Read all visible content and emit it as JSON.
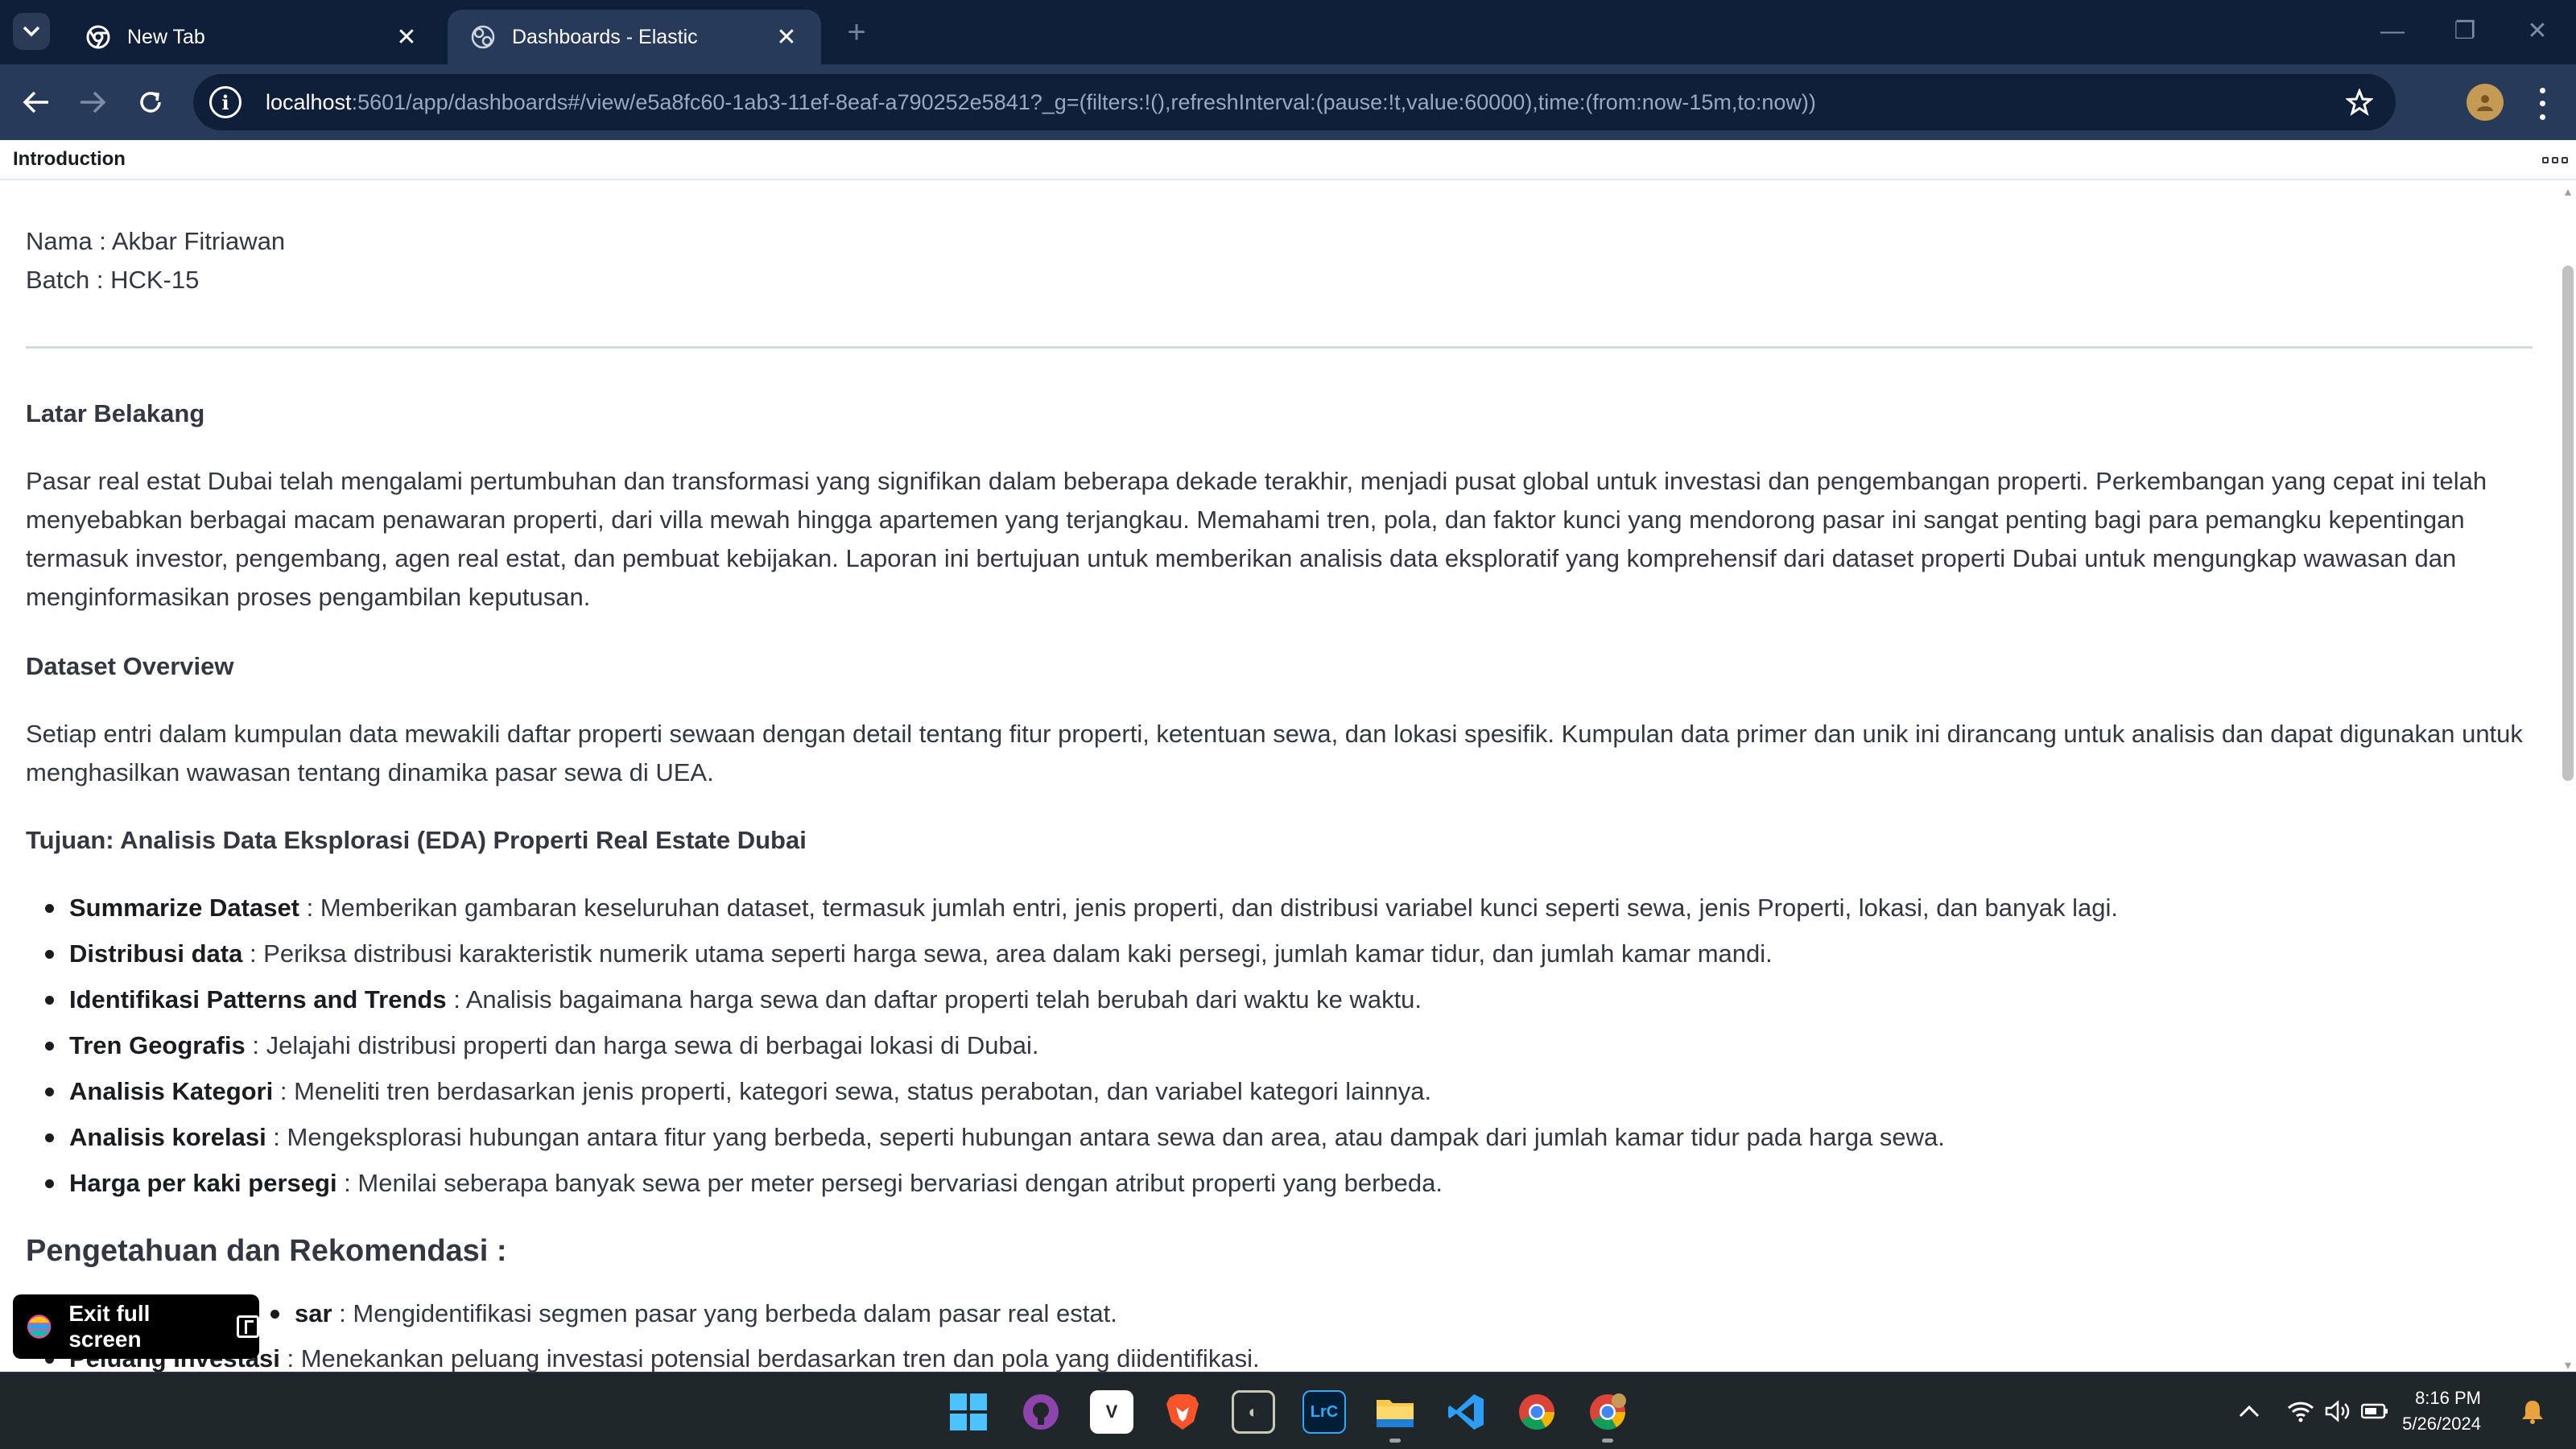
{
  "browser": {
    "tabs": [
      {
        "title": "New Tab",
        "active": false
      },
      {
        "title": "Dashboards - Elastic",
        "active": true
      }
    ],
    "url_host": "localhost",
    "url_rest": ":5601/app/dashboards#/view/e5a8fc60-1ab3-11ef-8eaf-a790252e5841?_g=(filters:!(),refreshInterval:(pause:!t,value:60000),time:(from:now-15m,to:now))"
  },
  "panel": {
    "title": "Introduction"
  },
  "content": {
    "nama": "Nama : Akbar Fitriawan",
    "batch": "Batch : HCK-15",
    "latar_heading": "Latar Belakang",
    "latar_text": "Pasar real estat Dubai telah mengalami pertumbuhan dan transformasi yang signifikan dalam beberapa dekade terakhir, menjadi pusat global untuk investasi dan pengembangan properti. Perkembangan yang cepat ini telah menyebabkan berbagai macam penawaran properti, dari villa mewah hingga apartemen yang terjangkau. Memahami tren, pola, dan faktor kunci yang mendorong pasar ini sangat penting bagi para pemangku kepentingan termasuk investor, pengembang, agen real estat, dan pembuat kebijakan. Laporan ini bertujuan untuk memberikan analisis data eksploratif yang komprehensif dari dataset properti Dubai untuk mengungkap wawasan dan menginformasikan proses pengambilan keputusan.",
    "dataset_heading": "Dataset Overview",
    "dataset_text": "Setiap entri dalam kumpulan data mewakili daftar properti sewaan dengan detail tentang fitur properti, ketentuan sewa, dan lokasi spesifik. Kumpulan data primer dan unik ini dirancang untuk analisis dan dapat digunakan untuk menghasilkan wawasan tentang dinamika pasar sewa di UEA.",
    "tujuan_heading": "Tujuan: Analisis Data Eksplorasi (EDA) Properti Real Estate Dubai",
    "tujuan_items": [
      {
        "term": "Summarize Dataset",
        "desc": " : Memberikan gambaran keseluruhan dataset, termasuk jumlah entri, jenis properti, dan distribusi variabel kunci seperti sewa, jenis Properti, lokasi, dan banyak lagi."
      },
      {
        "term": "Distribusi data",
        "desc": " : Periksa distribusi karakteristik numerik utama seperti harga sewa, area dalam kaki persegi, jumlah kamar tidur, dan jumlah kamar mandi."
      },
      {
        "term": "Identifikasi Patterns and Trends",
        "desc": " : Analisis bagaimana harga sewa dan daftar properti telah berubah dari waktu ke waktu."
      },
      {
        "term": "Tren Geografis",
        "desc": " : Jelajahi distribusi properti dan harga sewa di berbagai lokasi di Dubai."
      },
      {
        "term": "Analisis Kategori",
        "desc": " : Meneliti tren berdasarkan jenis properti, kategori sewa, status perabotan, dan variabel kategori lainnya."
      },
      {
        "term": "Analisis korelasi",
        "desc": " : Mengeksplorasi hubungan antara fitur yang berbeda, seperti hubungan antara sewa dan area, atau dampak dari jumlah kamar tidur pada harga sewa."
      },
      {
        "term": "Harga per kaki persegi",
        "desc": " : Menilai seberapa banyak sewa per meter persegi bervariasi dengan atribut properti yang berbeda."
      }
    ],
    "rekomendasi_heading": "Pengetahuan dan Rekomendasi :",
    "rekomendasi_items": [
      {
        "term": "sar",
        "desc": " : Mengidentifikasi segmen pasar yang berbeda dalam pasar real estat."
      },
      {
        "term": "Peluang Investasi",
        "desc": " : Menekankan peluang investasi potensial berdasarkan tren dan pola yang diidentifikasi."
      }
    ]
  },
  "fullscreen": {
    "label": "Exit full screen"
  },
  "taskbar": {
    "time": "8:16 PM",
    "date": "5/26/2024"
  },
  "colors": {
    "tab_strip": "#0f1f3a",
    "toolbar": "#283a5a",
    "text": "#343741",
    "taskbar": "#20272a"
  }
}
